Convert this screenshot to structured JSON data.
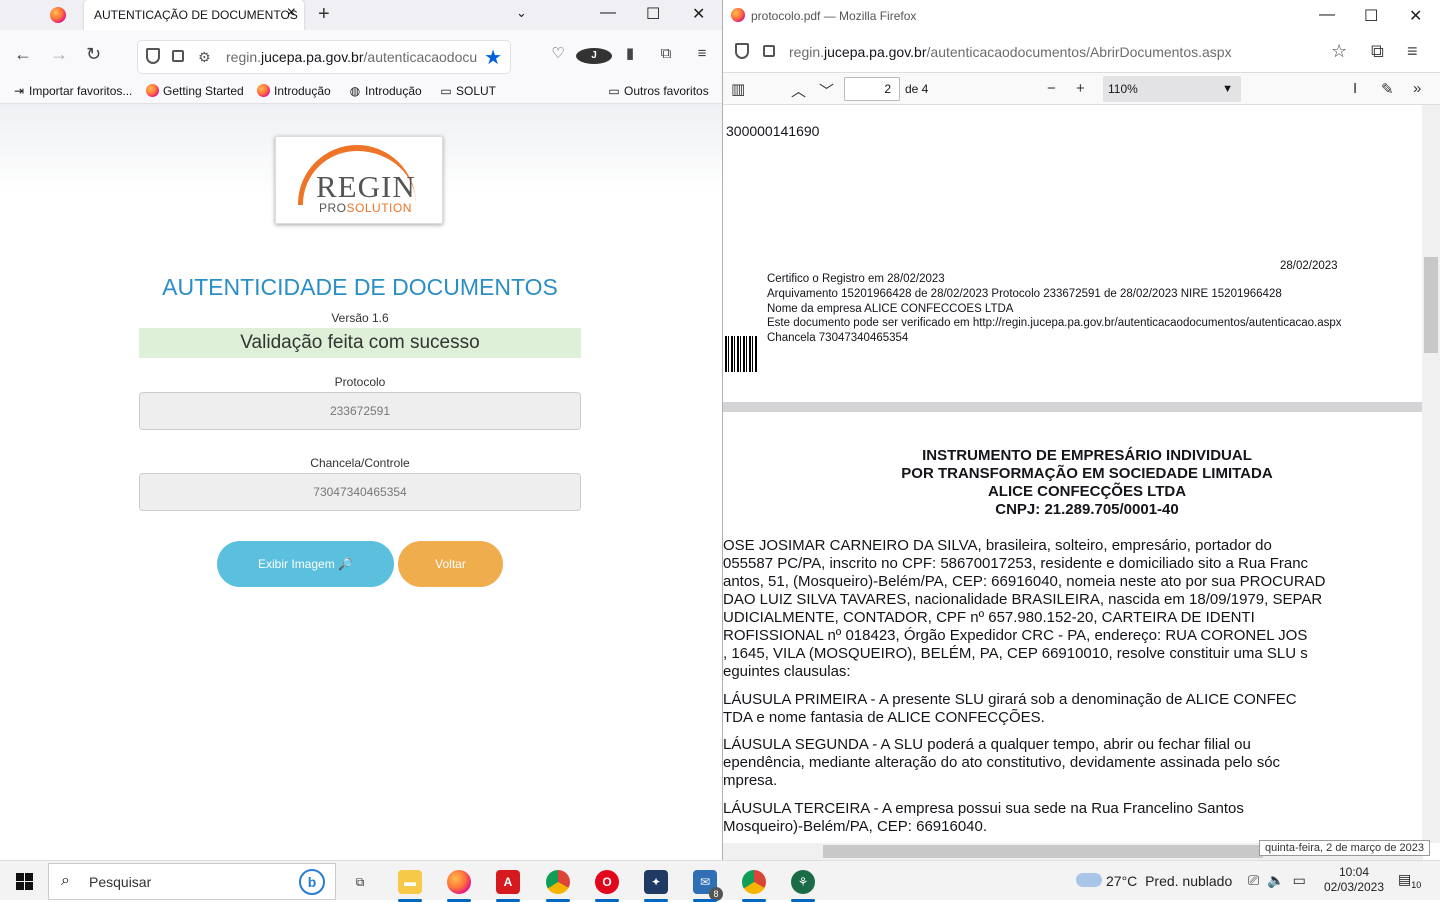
{
  "left_browser": {
    "tab_title": "AUTENTICAÇÃO DE DOCUMENTOS",
    "url_host": "regin.",
    "url_domain": "jucepa.pa.gov.br",
    "url_path": "/autenticacaodocumentos/autenticacao.aspx",
    "bookmarks": [
      "Importar favoritos...",
      "Getting Started",
      "Introdução",
      "Introdução",
      "SOLUT"
    ],
    "other_bookmarks": "Outros favoritos"
  },
  "page": {
    "logo_main": "REGIN",
    "logo_sub_a": "PRO",
    "logo_sub_b": "SOLUTION",
    "title": "AUTENTICIDADE DE DOCUMENTOS",
    "version": "Versão 1.6",
    "success": "Validação feita com sucesso",
    "protocol_label": "Protocolo",
    "protocol_value": "233672591",
    "chancela_label": "Chancela/Controle",
    "chancela_value": "73047340465354",
    "btn_image": "Exibir Imagem 🔎",
    "btn_back": "Voltar"
  },
  "right_browser": {
    "title": "protocolo.pdf — Mozilla Firefox",
    "url_host": "regin.",
    "url_domain": "jucepa.pa.gov.br",
    "url_path": "/autenticacaodocumentos/AbrirDocumentos.aspx",
    "page_current": "2",
    "page_of": "de 4",
    "zoom": "110%"
  },
  "pdf": {
    "top_number": "300000141690",
    "date": "28/02/2023",
    "cert_lines": [
      "Certifico o Registro em 28/02/2023",
      "Arquivamento 15201966428 de 28/02/2023 Protocolo 233672591 de 28/02/2023 NIRE 15201966428",
      "Nome da empresa ALICE CONFECCOES LTDA",
      "Este documento pode ser verificado em http://regin.jucepa.pa.gov.br/autenticacaodocumentos/autenticacao.aspx",
      "Chancela 73047340465354"
    ],
    "heading": [
      "INSTRUMENTO DE EMPRESÁRIO INDIVIDUAL",
      "POR TRANSFORMAÇÃO EM SOCIEDADE LIMITADA",
      "ALICE CONFECÇÕES LTDA",
      "CNPJ: 21.289.705/0001-40"
    ],
    "para1": [
      "OSE JOSIMAR CARNEIRO DA SILVA, brasileira, solteiro, empresário, portador do",
      "055587 PC/PA, inscrito no CPF: 58670017253, residente e domiciliado sito a Rua Franc",
      "antos, 51, (Mosqueiro)-Belém/PA, CEP: 66916040, nomeia neste ato por sua PROCURAD",
      "DAO LUIZ SILVA TAVARES, nacionalidade BRASILEIRA, nascida em 18/09/1979, SEPAR",
      "UDICIALMENTE, CONTADOR, CPF nº 657.980.152-20, CARTEIRA DE IDENTI",
      "ROFISSIONAL nº 018423, Órgão Expedidor CRC - PA, endereço: RUA CORONEL JOS",
      ", 1645, VILA (MOSQUEIRO), BELÉM, PA, CEP 66910010, resolve constituir uma SLU s",
      "eguintes clausulas:"
    ],
    "clause1": [
      "LÁUSULA PRIMEIRA - A presente SLU girará sob a denominação de ALICE CONFEC",
      "TDA e nome fantasia de ALICE CONFECÇÕES."
    ],
    "clause2": [
      "LÁUSULA SEGUNDA - A SLU poderá a qualquer tempo, abrir ou fechar filial ou",
      "ependência, mediante alteração do ato constitutivo, devidamente assinada pelo sóc",
      "mpresa."
    ],
    "clause3": [
      "LÁUSULA TERCEIRA - A empresa possui sua sede na Rua Francelino Santos",
      "Mosqueiro)-Belém/PA, CEP: 66916040."
    ],
    "tooltip": "quinta-feira, 2 de março de 2023"
  },
  "taskbar": {
    "search": "Pesquisar",
    "weather_temp": "27°C",
    "weather_text": "Pred. nublado",
    "time": "10:04",
    "date": "02/03/2023",
    "mail_count": "8",
    "notif_count": "10"
  }
}
